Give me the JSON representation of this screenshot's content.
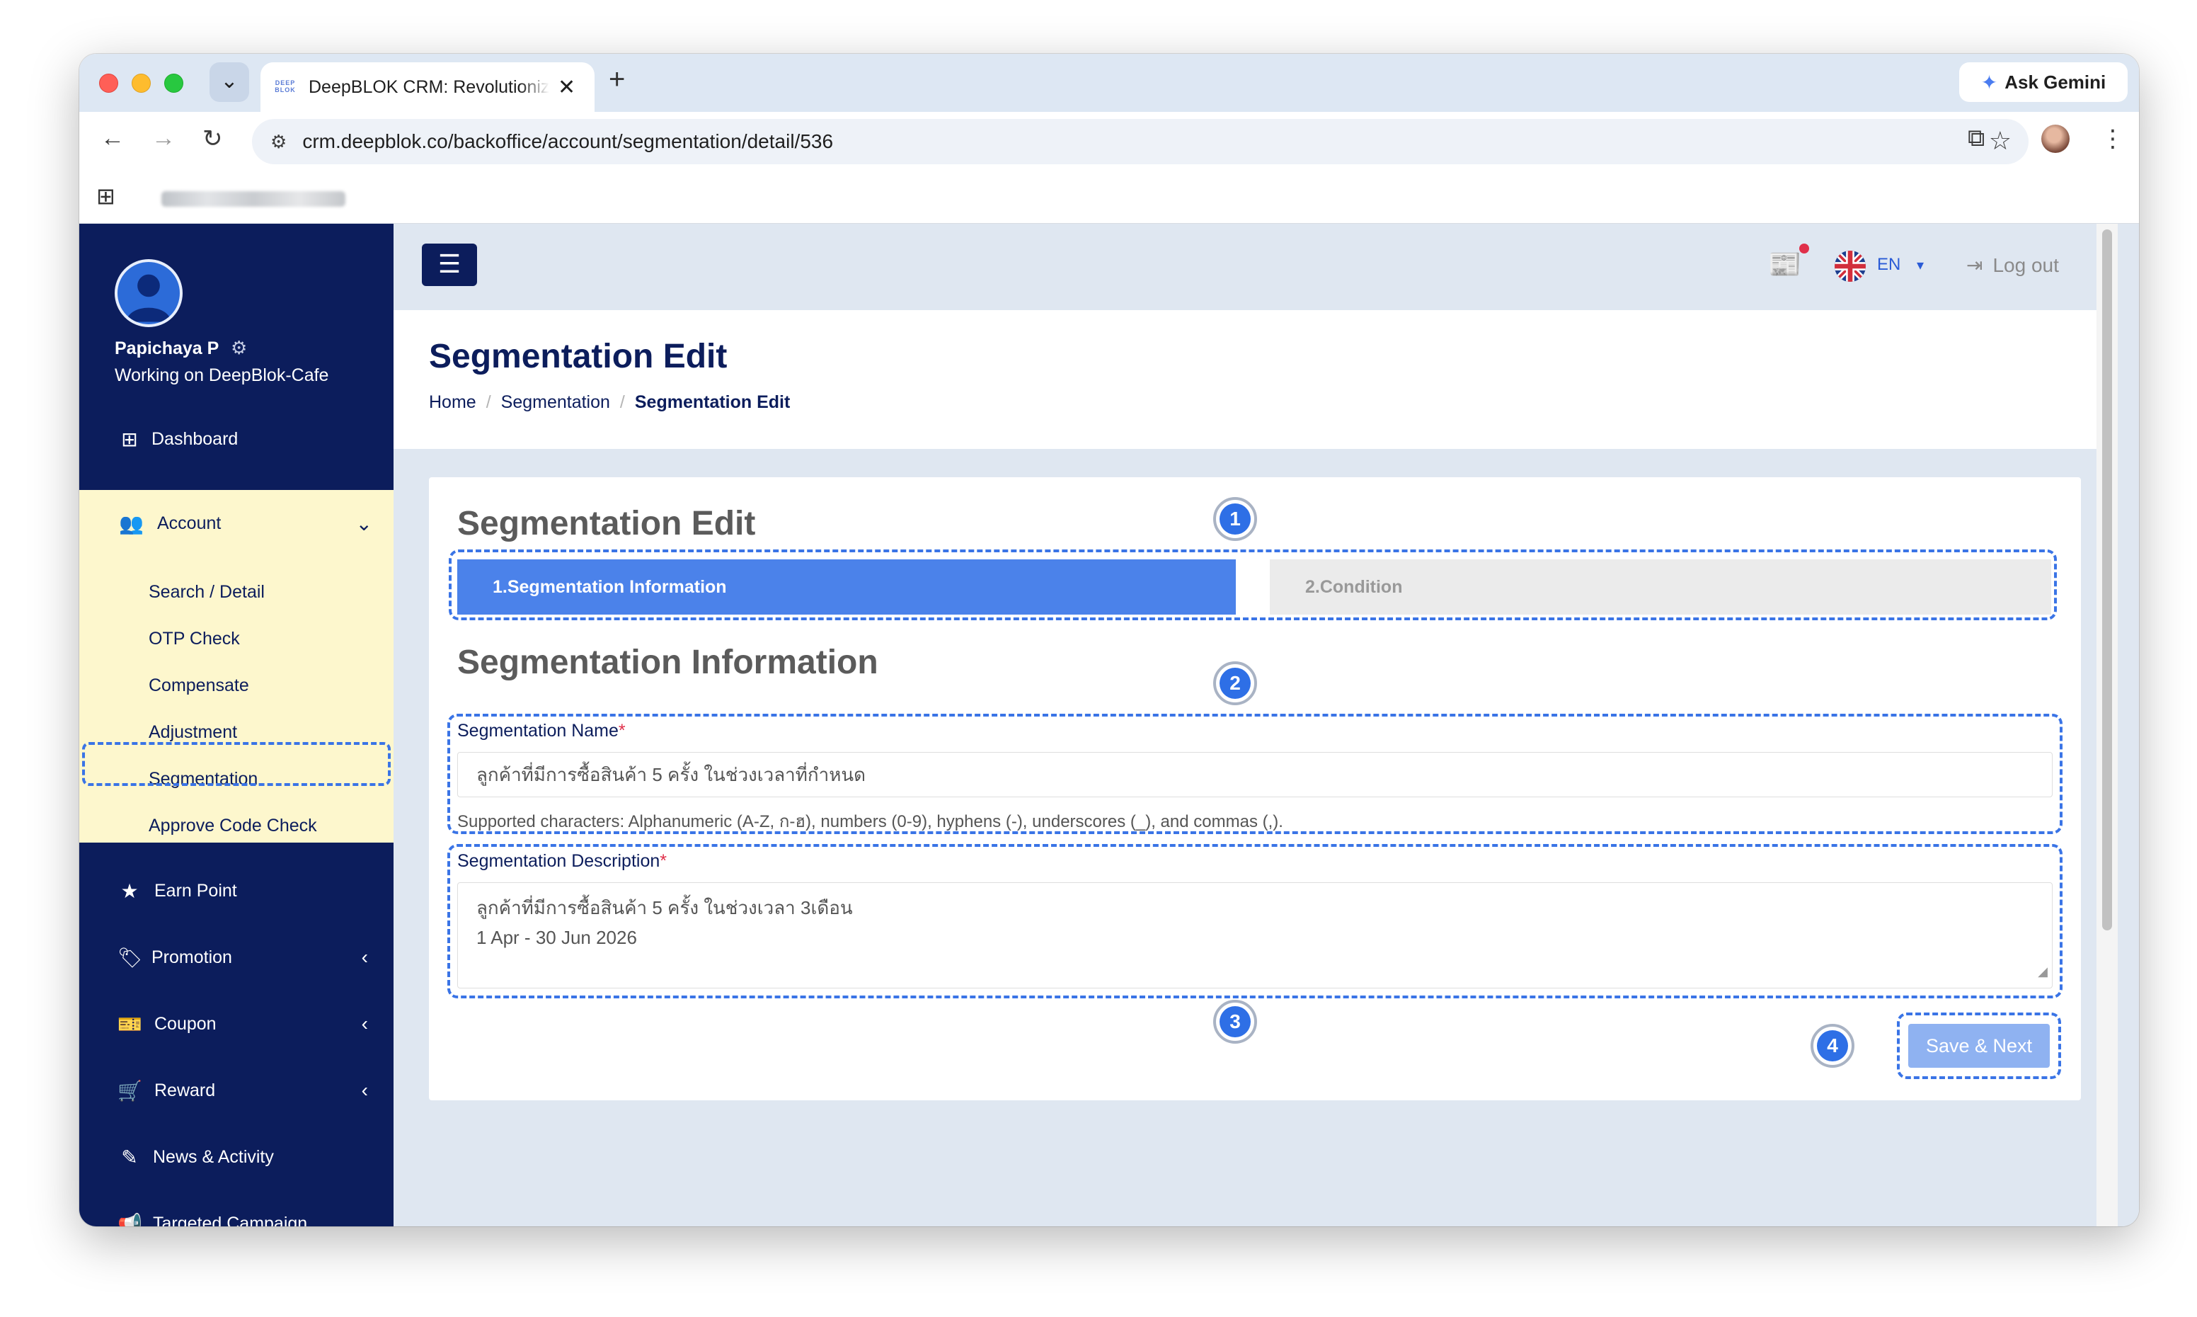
{
  "browser": {
    "tab_title": "DeepBLOK CRM: Revolutionize",
    "tab_favicon_text": "DEEP BLOK",
    "ask_gemini": "Ask Gemini",
    "url": "crm.deepblok.co/backoffice/account/segmentation/detail/536"
  },
  "user": {
    "name": "Papichaya P",
    "workspace": "Working on DeepBlok-Cafe"
  },
  "sidebar": {
    "dashboard": "Dashboard",
    "account": "Account",
    "account_items": [
      "Search / Detail",
      "OTP Check",
      "Compensate",
      "Adjustment",
      "Segmentation",
      "Approve Code Check"
    ],
    "earn_point": "Earn Point",
    "promotion": "Promotion",
    "coupon": "Coupon",
    "reward": "Reward",
    "news_activity": "News & Activity",
    "targeted_campaign": "Targeted Campaign"
  },
  "topbar": {
    "language": "EN",
    "logout": "Log out"
  },
  "header": {
    "title": "Segmentation Edit",
    "breadcrumb": [
      "Home",
      "Segmentation",
      "Segmentation Edit"
    ]
  },
  "card": {
    "title": "Segmentation Edit",
    "steps": [
      "1.Segmentation Information",
      "2.Condition"
    ],
    "section_title": "Segmentation Information",
    "name_label": "Segmentation Name",
    "name_value": "ลูกค้าที่มีการซื้อสินค้า 5 ครั้ง ในช่วงเวลาที่กำหนด",
    "name_hint": "Supported characters: Alphanumeric (A-Z, ก-ฮ), numbers (0-9), hyphens (-), underscores (_), and commas (,).",
    "description_label": "Segmentation Description",
    "description_lines": [
      "ลูกค้าที่มีการซื้อสินค้า 5 ครั้ง ในช่วงเวลา 3เดือน",
      "1 Apr - 30 Jun 2026"
    ],
    "save_button": "Save & Next",
    "required_mark": "*"
  },
  "markers": [
    "1",
    "2",
    "3",
    "4"
  ],
  "colors": {
    "sidebar_bg": "#0c1d5c",
    "accent": "#4b82ea",
    "highlight_bg": "#fdf7cd",
    "annotation": "#3a74e6"
  }
}
